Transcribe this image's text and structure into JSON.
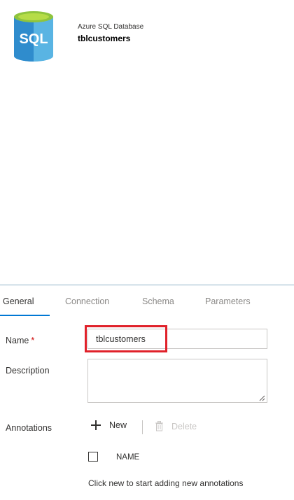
{
  "dataset": {
    "type_label": "Azure SQL Database",
    "name": "tblcustomers",
    "icon_text": "SQL"
  },
  "tabs": [
    {
      "label": "General",
      "active": true
    },
    {
      "label": "Connection",
      "active": false
    },
    {
      "label": "Schema",
      "active": false
    },
    {
      "label": "Parameters",
      "active": false
    }
  ],
  "form": {
    "name_label": "Name",
    "required_mark": "*",
    "name_value": "tblcustomers",
    "description_label": "Description",
    "description_value": "",
    "annotations_label": "Annotations"
  },
  "annotations": {
    "new_label": "New",
    "delete_label": "Delete",
    "column_header": "NAME",
    "empty_message": "Click new to start adding new annotations"
  },
  "colors": {
    "accent": "#0078d4",
    "highlight": "#e0212a",
    "icon_body": "#3f9bd8",
    "icon_top": "#9dc82f"
  }
}
